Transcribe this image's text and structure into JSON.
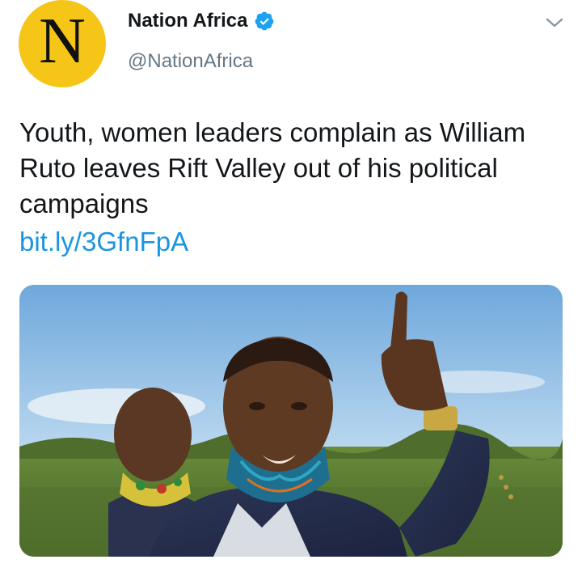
{
  "account": {
    "avatar_letter": "N",
    "display_name": "Nation Africa",
    "handle": "@NationAfrica",
    "verified": true,
    "avatar_color": "#f5c518"
  },
  "tweet": {
    "text": "Youth, women leaders complain as William Ruto leaves Rift Valley out of his political campaigns",
    "link": "bit.ly/3GfnFpA",
    "link_color": "#1b95e0"
  },
  "icons": {
    "verified": "verified-badge-icon",
    "menu": "chevron-down-icon"
  }
}
